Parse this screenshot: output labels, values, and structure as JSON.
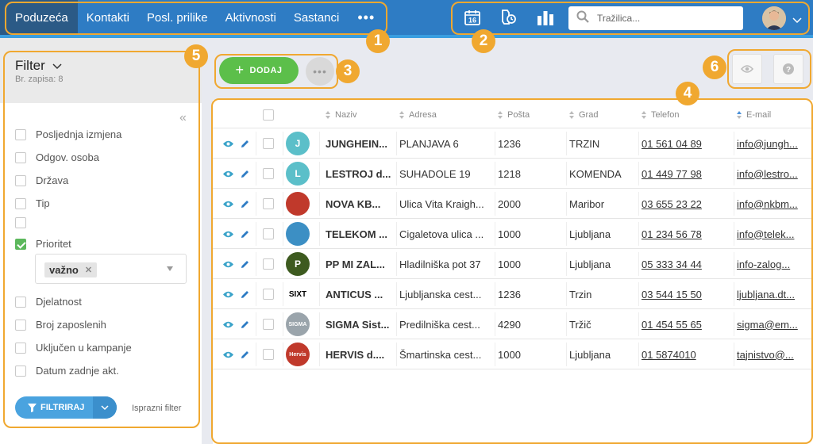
{
  "nav": {
    "items": [
      "Poduzeća",
      "Kontakti",
      "Posl. prilike",
      "Aktivnosti",
      "Sastanci"
    ],
    "more": "•••"
  },
  "toolbar": {
    "calendar_day": "16",
    "search_placeholder": "Tražilica..."
  },
  "callouts": [
    "1",
    "2",
    "3",
    "4",
    "5",
    "6"
  ],
  "sidebar": {
    "title": "Filter",
    "record_count": "Br. zapisa: 8",
    "items": [
      {
        "label": "Posljednja izmjena",
        "checked": false
      },
      {
        "label": "Odgov. osoba",
        "checked": false
      },
      {
        "label": "Država",
        "checked": false
      },
      {
        "label": "Tip",
        "checked": false
      },
      {
        "label": "",
        "checked": false
      },
      {
        "label": "Prioritet",
        "checked": true
      },
      {
        "label": "Djelatnost",
        "checked": false
      },
      {
        "label": "Broj zaposlenih",
        "checked": false
      },
      {
        "label": "Uključen u kampanje",
        "checked": false
      },
      {
        "label": "Datum zadnje akt.",
        "checked": false
      }
    ],
    "priority_tag": "važno",
    "filter_button": "FILTRIRAJ",
    "clear_filter": "Isprazni filter"
  },
  "actions": {
    "add_label": "DODAJ",
    "more": "•••"
  },
  "table": {
    "headers": [
      "Naziv",
      "Adresa",
      "Pošta",
      "Grad",
      "Telefon",
      "E-mail"
    ],
    "rows": [
      {
        "logo": "J",
        "logo_color": "#5bbfc9",
        "name": "JUNGHEIN...",
        "address": "PLANJAVA 6",
        "post": "1236",
        "city": "TRZIN",
        "phone": "01 561 04 89",
        "email": "info@jungh..."
      },
      {
        "logo": "L",
        "logo_color": "#5bbfc9",
        "name": "LESTROJ d...",
        "address": "SUHADOLE 19",
        "post": "1218",
        "city": "KOMENDA",
        "phone": "01 449 77 98",
        "email": "info@lestro..."
      },
      {
        "logo": "",
        "logo_color": "#c0392b",
        "name": "NOVA KB...",
        "address": "Ulica Vita Kraigh...",
        "post": "2000",
        "city": "Maribor",
        "phone": "03 655 23 22",
        "email": "info@nkbm..."
      },
      {
        "logo": "",
        "logo_color": "#3c8fc4",
        "name": "TELEKOM ...",
        "address": "Cigaletova ulica ...",
        "post": "1000",
        "city": "Ljubljana",
        "phone": "01 234 56 78",
        "email": "info@telek..."
      },
      {
        "logo": "P",
        "logo_color": "#3d5a1f",
        "name": "PP MI ZAL...",
        "address": "Hladilniška pot 37",
        "post": "1000",
        "city": "Ljubljana",
        "phone": "05 333 34 44",
        "email": "info-zalog..."
      },
      {
        "logo": "SIXT",
        "logo_color": "#ffffff",
        "name": "ANTICUS ...",
        "address": "Ljubljanska cest...",
        "post": "1236",
        "city": "Trzin",
        "phone": "03 544 15 50",
        "email": "ljubljana.dt..."
      },
      {
        "logo": "SIGMA",
        "logo_color": "#9aa4ab",
        "name": "SIGMA Sist...",
        "address": "Predilniška cest...",
        "post": "4290",
        "city": "Tržič",
        "phone": "01 454 55 65",
        "email": "sigma@em..."
      },
      {
        "logo": "Hervis",
        "logo_color": "#c0392b",
        "name": "HERVIS d....",
        "address": "Šmartinska cest...",
        "post": "1000",
        "city": "Ljubljana",
        "phone": "01 5874010",
        "email": "tajnistvo@..."
      }
    ]
  },
  "colors": {
    "topbar": "#2e7cc4",
    "nav_active": "#2b5a86",
    "callout": "#f0a830",
    "add_button": "#5cbf4a",
    "filter_button": "#4aa3df",
    "action_icon": "#3aa3c9"
  }
}
